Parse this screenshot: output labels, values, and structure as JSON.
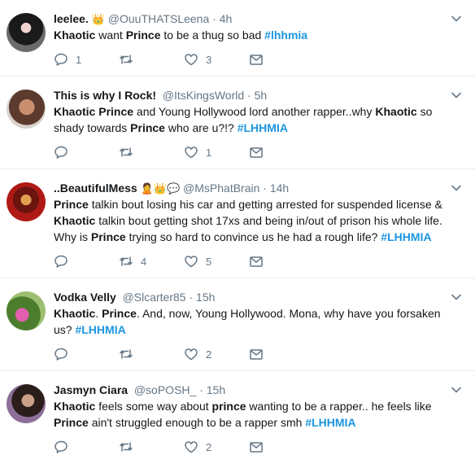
{
  "colors": {
    "link": "#1b95e0",
    "muted": "#657786",
    "text": "#14171a",
    "divider": "#e6ecf0"
  },
  "tweets": [
    {
      "name": "leelee.",
      "emoji": "👑",
      "handle": "@OuuTHATSLeena",
      "time": "4h",
      "text_parts": [
        {
          "t": "Khaotic",
          "s": "bold"
        },
        {
          "t": " want ",
          "s": "plain"
        },
        {
          "t": "Prince",
          "s": "bold"
        },
        {
          "t": " to be a thug so bad ",
          "s": "plain"
        },
        {
          "t": "#lhhmia",
          "s": "hashtag"
        }
      ],
      "reply_count": "1",
      "retweet_count": "",
      "like_count": "3"
    },
    {
      "name": "This is why I Rock!",
      "emoji": "",
      "handle": "@ItsKingsWorld",
      "time": "5h",
      "text_parts": [
        {
          "t": "Khaotic",
          "s": "bold"
        },
        {
          "t": " ",
          "s": "plain"
        },
        {
          "t": "Prince",
          "s": "bold"
        },
        {
          "t": " and Young Hollywood lord another rapper..why ",
          "s": "plain"
        },
        {
          "t": "Khaotic",
          "s": "bold"
        },
        {
          "t": " so shady towards ",
          "s": "plain"
        },
        {
          "t": "Prince",
          "s": "bold"
        },
        {
          "t": " who are u?!? ",
          "s": "plain"
        },
        {
          "t": "#LHHMIA",
          "s": "hashtag"
        }
      ],
      "reply_count": "",
      "retweet_count": "",
      "like_count": "1"
    },
    {
      "name": "..BeautifulMess",
      "emoji": "🙎👑💬",
      "handle": "@MsPhatBrain",
      "time": "14h",
      "text_parts": [
        {
          "t": "Prince",
          "s": "bold"
        },
        {
          "t": " talkin  bout losing his car and getting arrested for suspended license & ",
          "s": "plain"
        },
        {
          "t": "Khaotic",
          "s": "bold"
        },
        {
          "t": " talkin bout getting shot 17xs and being in/out of prison his whole life. Why is ",
          "s": "plain"
        },
        {
          "t": "Prince",
          "s": "bold"
        },
        {
          "t": " trying so hard to convince us he had a rough life? ",
          "s": "plain"
        },
        {
          "t": "#LHHMIA",
          "s": "hashtag"
        }
      ],
      "reply_count": "",
      "retweet_count": "4",
      "like_count": "5"
    },
    {
      "name": "Vodka Velly",
      "emoji": "",
      "handle": "@Slcarter85",
      "time": "15h",
      "text_parts": [
        {
          "t": "Khaotic",
          "s": "bold"
        },
        {
          "t": ". ",
          "s": "plain"
        },
        {
          "t": "Prince",
          "s": "bold"
        },
        {
          "t": ". And, now, Young Hollywood. Mona, why have you forsaken us? ",
          "s": "plain"
        },
        {
          "t": "#LHHMIA",
          "s": "hashtag"
        }
      ],
      "reply_count": "",
      "retweet_count": "",
      "like_count": "2"
    },
    {
      "name": "Jasmyn Ciara",
      "emoji": "",
      "handle": "@soPOSH_",
      "time": "15h",
      "text_parts": [
        {
          "t": "Khaotic",
          "s": "bold"
        },
        {
          "t": " feels some way about ",
          "s": "plain"
        },
        {
          "t": "prince",
          "s": "bold"
        },
        {
          "t": " wanting to be a rapper.. he feels like ",
          "s": "plain"
        },
        {
          "t": "Prince",
          "s": "bold"
        },
        {
          "t": " ain't struggled enough to be a rapper smh  ",
          "s": "plain"
        },
        {
          "t": "#LHHMIA",
          "s": "hashtag"
        }
      ],
      "reply_count": "",
      "retweet_count": "",
      "like_count": "2"
    }
  ]
}
